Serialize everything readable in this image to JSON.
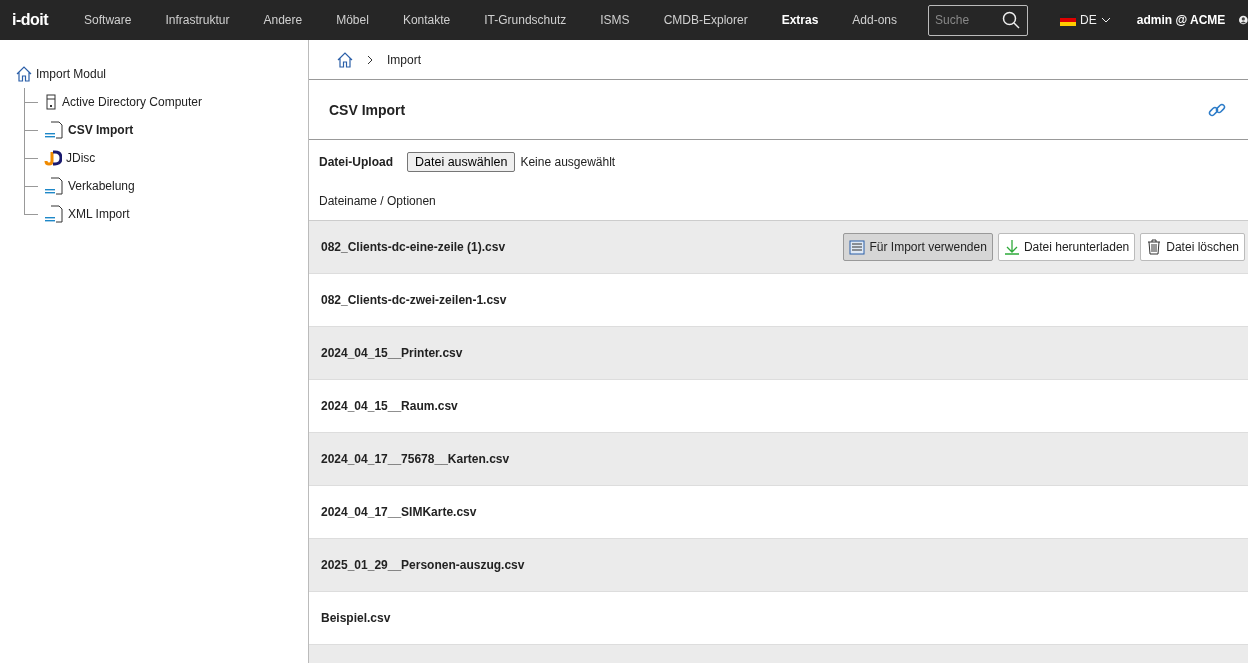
{
  "topbar": {
    "logo": "i-doit",
    "nav": [
      {
        "label": "Software",
        "selected": false
      },
      {
        "label": "Infrastruktur",
        "selected": false
      },
      {
        "label": "Andere",
        "selected": false
      },
      {
        "label": "Möbel",
        "selected": false
      },
      {
        "label": "Kontakte",
        "selected": false
      },
      {
        "label": "IT-Grundschutz",
        "selected": false
      },
      {
        "label": "ISMS",
        "selected": false
      },
      {
        "label": "CMDB-Explorer",
        "selected": false
      },
      {
        "label": "Extras",
        "selected": true
      },
      {
        "label": "Add-ons",
        "selected": false
      }
    ],
    "search": {
      "placeholder": "Suche"
    },
    "language": "DE",
    "user": "admin @ ",
    "tenant": "ACME"
  },
  "sidebar": {
    "root": {
      "label": "Import Modul",
      "children": [
        {
          "label": "Active Directory Computer",
          "kind": "server",
          "selected": false
        },
        {
          "label": "CSV Import",
          "kind": "csv",
          "selected": true
        },
        {
          "label": "JDisc",
          "kind": "jdisc",
          "selected": false
        },
        {
          "label": "Verkabelung",
          "kind": "cable",
          "selected": false
        },
        {
          "label": "XML Import",
          "kind": "xml",
          "selected": false
        }
      ]
    }
  },
  "breadcrumb": [
    "Import"
  ],
  "title": "CSV Import",
  "upload": {
    "label": "Datei-Upload",
    "button": "Datei auswählen",
    "status": "Keine ausgewählt"
  },
  "table": {
    "header": "Dateiname / Optionen",
    "rows": [
      {
        "name": "082_Clients-dc-eine-zeile (1).csv",
        "actions": [
          {
            "kind": "use",
            "label": "Für Import verwenden",
            "highlighted": true
          },
          {
            "kind": "download",
            "label": "Datei herunterladen",
            "highlighted": false
          },
          {
            "kind": "delete",
            "label": "Datei löschen",
            "highlighted": false
          }
        ]
      },
      {
        "name": "082_Clients-dc-zwei-zeilen-1.csv"
      },
      {
        "name": "2024_04_15__Printer.csv"
      },
      {
        "name": "2024_04_15__Raum.csv"
      },
      {
        "name": "2024_04_17__75678__Karten.csv"
      },
      {
        "name": "2024_04_17__SIMKarte.csv"
      },
      {
        "name": "2025_01_29__Personen-auszug.csv"
      },
      {
        "name": "Beispiel.csv"
      }
    ]
  }
}
